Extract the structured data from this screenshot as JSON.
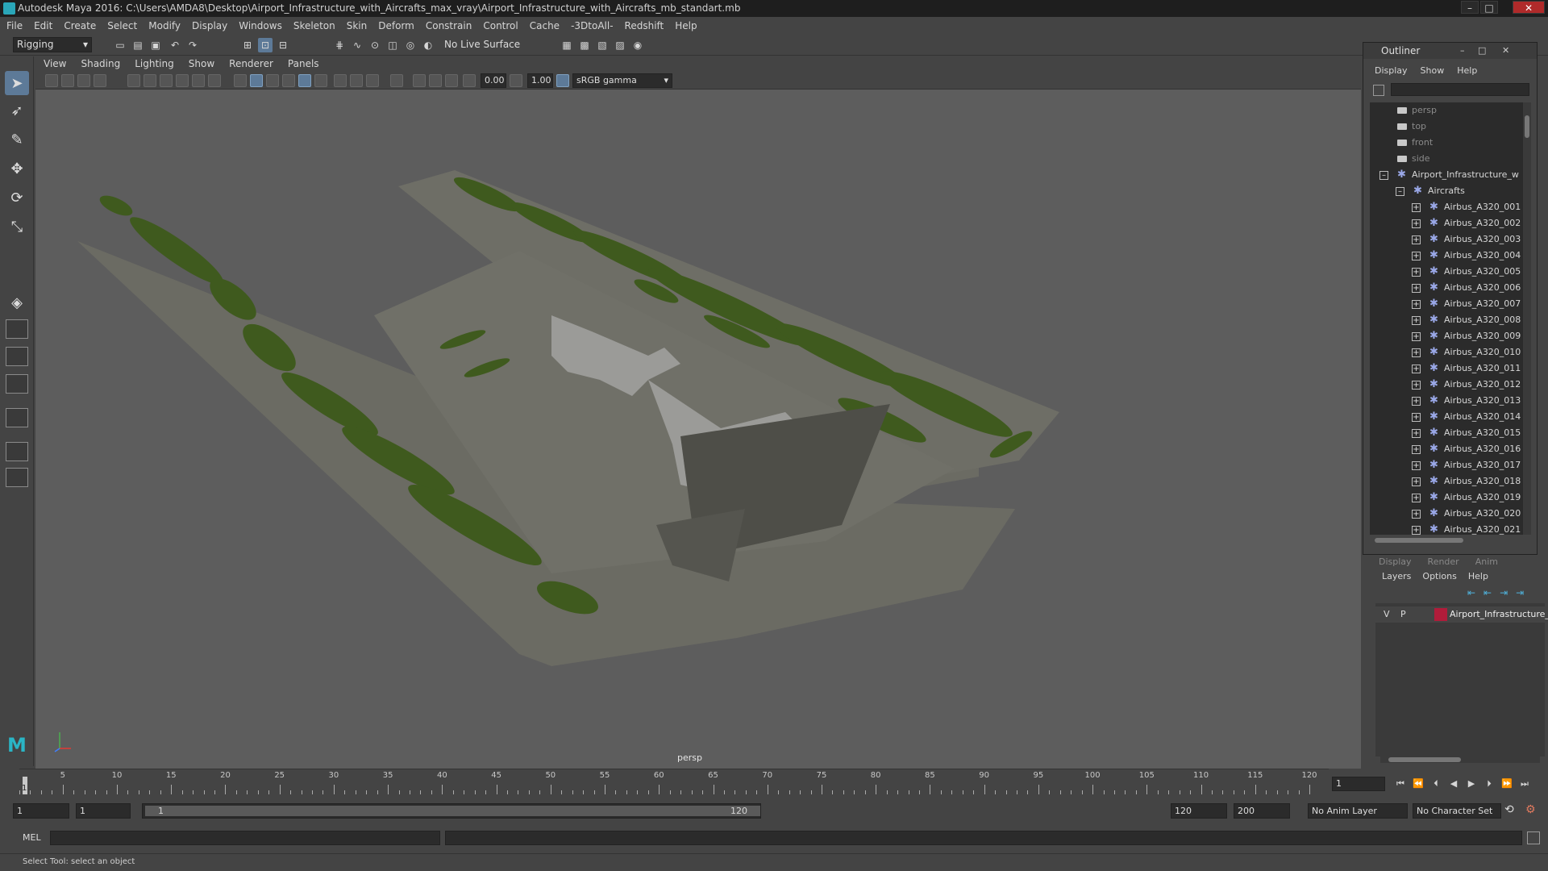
{
  "window": {
    "title": "Autodesk Maya 2016: C:\\Users\\AMDA8\\Desktop\\Airport_Infrastructure_with_Aircrafts_max_vray\\Airport_Infrastructure_with_Aircrafts_mb_standart.mb",
    "minimize": "–",
    "maximize": "□",
    "close": "✕"
  },
  "menubar": [
    "File",
    "Edit",
    "Create",
    "Select",
    "Modify",
    "Display",
    "Windows",
    "Skeleton",
    "Skin",
    "Deform",
    "Constrain",
    "Control",
    "Cache",
    "-3DtoAll-",
    "Redshift",
    "Help"
  ],
  "statusline": {
    "mode": "Rigging",
    "live_surface": "No Live Surface"
  },
  "panel": {
    "menus": [
      "View",
      "Shading",
      "Lighting",
      "Show",
      "Renderer",
      "Panels"
    ],
    "exposure": "0.00",
    "gamma": "1.00",
    "color_space": "sRGB gamma",
    "camera_label": "persp"
  },
  "outliner": {
    "title": "Outliner",
    "menus": [
      "Display",
      "Show",
      "Help"
    ],
    "cameras": [
      "persp",
      "top",
      "front",
      "side"
    ],
    "root": "Airport_Infrastructure_w",
    "group": "Aircrafts",
    "items": [
      "Airbus_A320_001",
      "Airbus_A320_002",
      "Airbus_A320_003",
      "Airbus_A320_004",
      "Airbus_A320_005",
      "Airbus_A320_006",
      "Airbus_A320_007",
      "Airbus_A320_008",
      "Airbus_A320_009",
      "Airbus_A320_010",
      "Airbus_A320_011",
      "Airbus_A320_012",
      "Airbus_A320_013",
      "Airbus_A320_014",
      "Airbus_A320_015",
      "Airbus_A320_016",
      "Airbus_A320_017",
      "Airbus_A320_018",
      "Airbus_A320_019",
      "Airbus_A320_020",
      "Airbus_A320_021"
    ]
  },
  "layers": {
    "tabs": [
      "Display",
      "Render",
      "Anim"
    ],
    "menus": [
      "Layers",
      "Options",
      "Help"
    ],
    "row": {
      "visible": "V",
      "playback": "P",
      "name": "Airport_Infrastructure_",
      "color": "#b01c3a"
    }
  },
  "timeline": {
    "ticks": [
      "5",
      "10",
      "15",
      "20",
      "25",
      "30",
      "35",
      "40",
      "45",
      "50",
      "55",
      "60",
      "65",
      "70",
      "75",
      "80",
      "85",
      "90",
      "95",
      "100",
      "105",
      "110",
      "115",
      "120"
    ],
    "current_frame_label": "1",
    "current_frame": "1"
  },
  "range": {
    "start": "1",
    "playback_start": "1",
    "range_start_label": "1",
    "range_end_label": "120",
    "playback_end": "120",
    "end": "200",
    "anim_layer": "No Anim Layer",
    "character_set": "No Character Set"
  },
  "command": {
    "mel_label": "MEL",
    "help_text": "Select Tool: select an object"
  },
  "colors": {
    "accent": "#5d7a98",
    "grass": "#3f5a1e",
    "tarmac": "#6b6b63",
    "layer": "#b01c3a"
  }
}
